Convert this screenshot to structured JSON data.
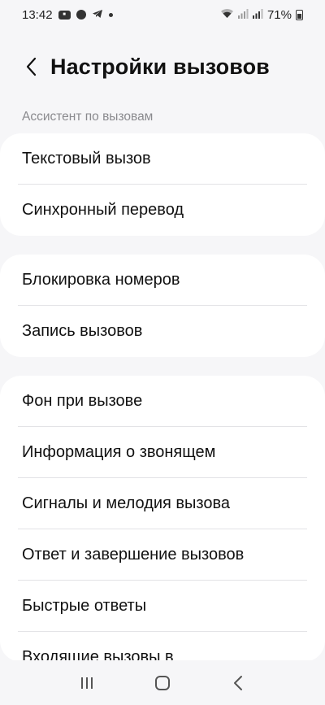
{
  "status": {
    "time": "13:42",
    "battery": "71%"
  },
  "header": {
    "title": "Настройки вызовов"
  },
  "sections": {
    "assistant_label": "Ассистент по вызовам"
  },
  "groups": [
    {
      "items": [
        {
          "label": "Текстовый вызов"
        },
        {
          "label": "Синхронный перевод"
        }
      ]
    },
    {
      "items": [
        {
          "label": "Блокировка номеров"
        },
        {
          "label": "Запись вызовов"
        }
      ]
    },
    {
      "items": [
        {
          "label": "Фон при вызове"
        },
        {
          "label": "Информация о звонящем"
        },
        {
          "label": "Сигналы и мелодия вызова"
        },
        {
          "label": "Ответ и завершение вызовов"
        },
        {
          "label": "Быстрые ответы"
        },
        {
          "label": "Входящие вызовы в"
        }
      ]
    }
  ],
  "icons": {
    "back": "chevron-left-icon",
    "nav_recents": "recents-icon",
    "nav_home": "home-icon",
    "nav_back": "back-icon"
  }
}
